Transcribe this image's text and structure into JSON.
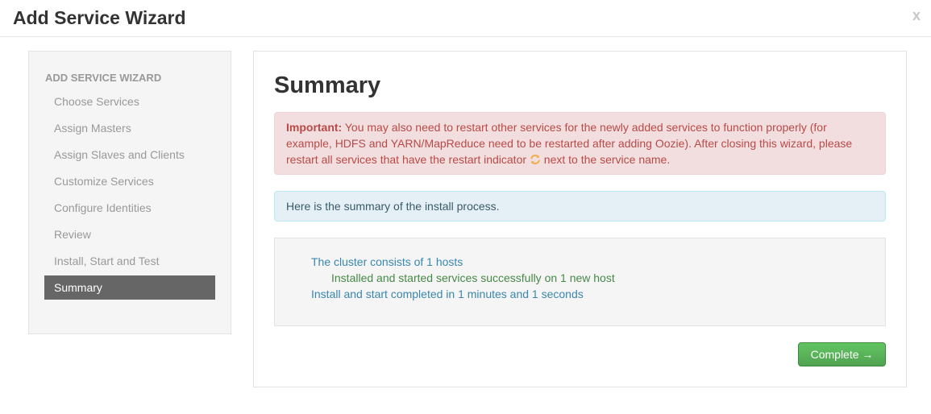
{
  "header": {
    "title": "Add Service Wizard",
    "close_label": "x"
  },
  "sidebar": {
    "heading": "ADD SERVICE WIZARD",
    "items": [
      {
        "label": "Choose Services",
        "active": false
      },
      {
        "label": "Assign Masters",
        "active": false
      },
      {
        "label": "Assign Slaves and Clients",
        "active": false
      },
      {
        "label": "Customize Services",
        "active": false
      },
      {
        "label": "Configure Identities",
        "active": false
      },
      {
        "label": "Review",
        "active": false
      },
      {
        "label": "Install, Start and Test",
        "active": false
      },
      {
        "label": "Summary",
        "active": true
      }
    ]
  },
  "main": {
    "title": "Summary",
    "important_alert": {
      "label": "Important:",
      "text_before_icon": " You may also need to restart other services for the newly added services to function properly (for example, HDFS and YARN/MapReduce need to be restarted after adding Oozie). After closing this wizard, please restart all services that have the restart indicator ",
      "icon": "refresh-icon",
      "text_after_icon": " next to the service name."
    },
    "info_alert": "Here is the summary of the install process.",
    "summary_lines": {
      "cluster": "The cluster consists of 1 hosts",
      "installed": "Installed and started services successfully on 1 new host",
      "completed": "Install and start completed in 1 minutes and 1 seconds"
    },
    "complete_button": "Complete →"
  },
  "colors": {
    "active_nav_bg": "#666666",
    "error_text": "#b94a48",
    "info_bg": "#e5f0f6",
    "success_button": "#51a351",
    "summary_blue": "#3a87ad",
    "summary_green": "#468847",
    "restart_icon": "#f0ad4e"
  }
}
